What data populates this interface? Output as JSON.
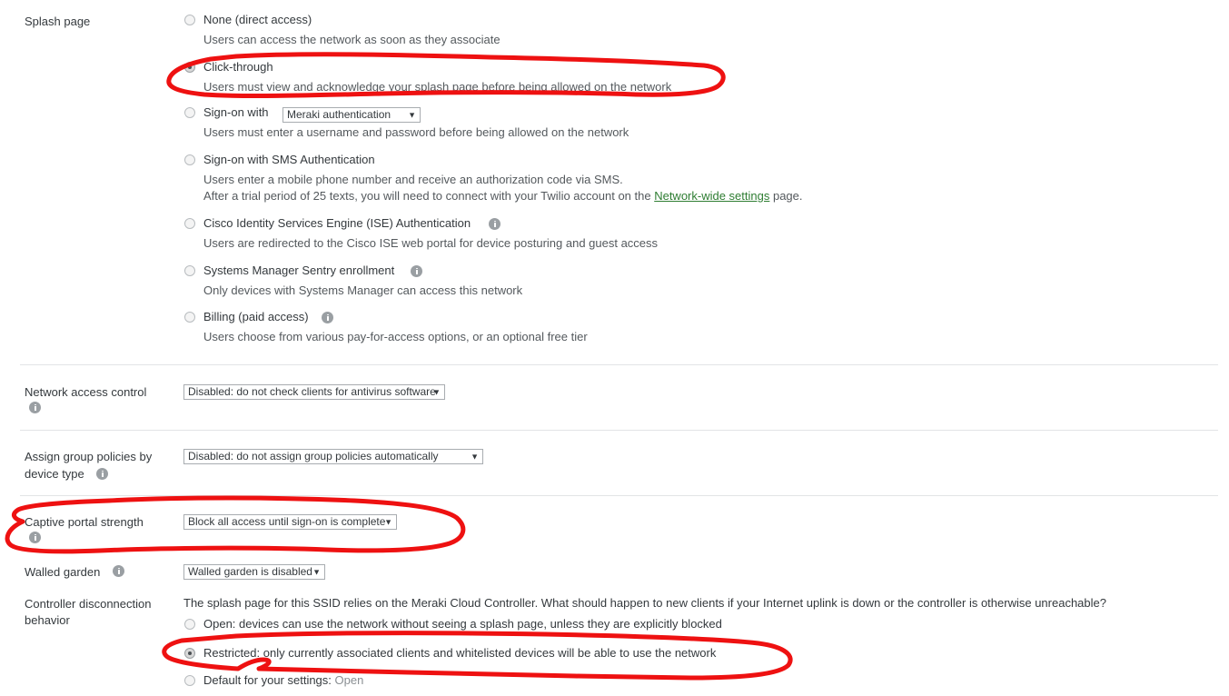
{
  "splash": {
    "label": "Splash page",
    "options": [
      {
        "title": "None (direct access)",
        "desc": "Users can access the network as soon as they associate",
        "selected": false
      },
      {
        "title": "Click-through",
        "desc": "Users must view and acknowledge your splash page before being allowed on the network",
        "selected": true
      },
      {
        "title": "Sign-on with",
        "desc": "Users must enter a username and password before being allowed on the network",
        "selected": false,
        "dropdown": "Meraki authentication"
      },
      {
        "title": "Sign-on with SMS Authentication",
        "desc": "Users enter a mobile phone number and receive an authorization code via SMS.",
        "desc2_pre": "After a trial period of 25 texts, you will need to connect with your Twilio account on the ",
        "desc2_link": "Network-wide settings",
        "desc2_post": " page.",
        "selected": false
      },
      {
        "title": "Cisco Identity Services Engine (ISE) Authentication",
        "desc": "Users are redirected to the Cisco ISE web portal for device posturing and guest access",
        "selected": false,
        "info": true
      },
      {
        "title": "Systems Manager Sentry enrollment",
        "desc": "Only devices with Systems Manager can access this network",
        "selected": false,
        "info": true
      },
      {
        "title": "Billing (paid access)",
        "desc": "Users choose from various pay-for-access options, or an optional free tier",
        "selected": false,
        "info": true
      }
    ]
  },
  "nac": {
    "label": "Network access control",
    "value": "Disabled: do not check clients for antivirus software",
    "caret": "▼"
  },
  "group_policies": {
    "label_line1": "Assign group policies by",
    "label_line2": "device type",
    "value": "Disabled: do not assign group policies automatically",
    "caret": "▼"
  },
  "captive_portal": {
    "label": "Captive portal strength",
    "value": "Block all access until sign-on is complete",
    "caret": "▼"
  },
  "walled_garden": {
    "label": "Walled garden",
    "value": "Walled garden is disabled",
    "caret": "▼"
  },
  "controller": {
    "label_line1": "Controller disconnection",
    "label_line2": "behavior",
    "intro": "The splash page for this SSID relies on the Meraki Cloud Controller. What should happen to new clients if your Internet uplink is down or the controller is otherwise unreachable?",
    "options": [
      {
        "title": "Open: devices can use the network without seeing a splash page, unless they are explicitly blocked",
        "selected": false
      },
      {
        "title": "Restricted: only currently associated clients and whitelisted devices will be able to use the network",
        "selected": true
      },
      {
        "title_pre": "Default for your settings: ",
        "title_dim": "Open",
        "selected": false
      }
    ]
  },
  "annotations": {
    "color": "#ee1111",
    "shapes": [
      {
        "name": "click-through-circle"
      },
      {
        "name": "captive-portal-circle"
      },
      {
        "name": "restricted-circle"
      }
    ]
  }
}
